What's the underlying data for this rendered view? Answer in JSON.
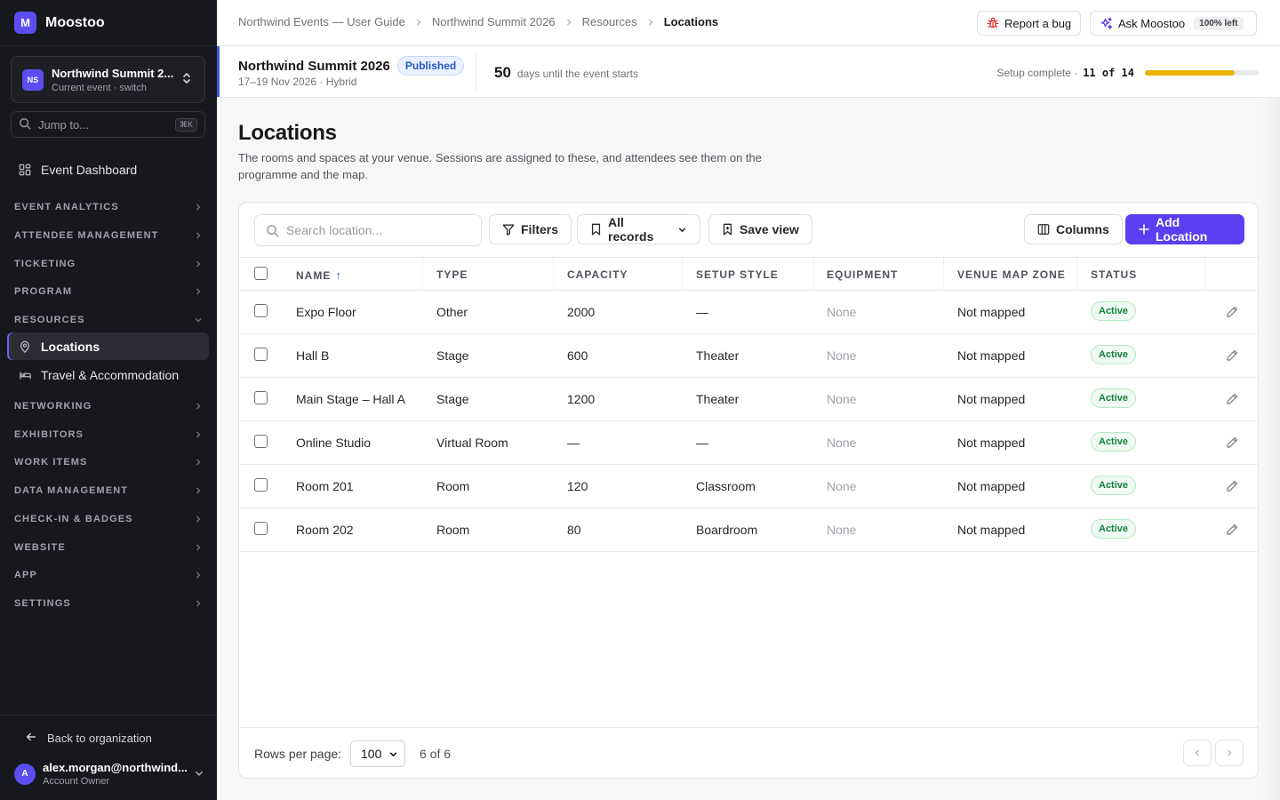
{
  "app": {
    "logo_letter": "M",
    "name": "Moostoo",
    "accent": "#5b3ff0"
  },
  "sidebar": {
    "event": {
      "initials": "NS",
      "name": "Northwind Summit 2...",
      "subtitle": "Current event · switch"
    },
    "jump": {
      "placeholder": "Jump to...",
      "shortcut": "⌘K"
    },
    "dashboard_label": "Event Dashboard",
    "sections": [
      {
        "label": "EVENT ANALYTICS",
        "expanded": false
      },
      {
        "label": "ATTENDEE MANAGEMENT",
        "expanded": false
      },
      {
        "label": "TICKETING",
        "expanded": false
      },
      {
        "label": "PROGRAM",
        "expanded": false
      },
      {
        "label": "RESOURCES",
        "expanded": true
      },
      {
        "label": "NETWORKING",
        "expanded": false
      },
      {
        "label": "EXHIBITORS",
        "expanded": false
      },
      {
        "label": "WORK ITEMS",
        "expanded": false
      },
      {
        "label": "DATA MANAGEMENT",
        "expanded": false
      },
      {
        "label": "CHECK-IN & BADGES",
        "expanded": false
      },
      {
        "label": "WEBSITE",
        "expanded": false
      },
      {
        "label": "APP",
        "expanded": false
      },
      {
        "label": "SETTINGS",
        "expanded": false
      }
    ],
    "resources_items": [
      {
        "label": "Locations",
        "icon": "map-pin-icon",
        "active": true
      },
      {
        "label": "Travel & Accommodation",
        "icon": "bed-icon",
        "active": false
      }
    ],
    "back_label": "Back to organization",
    "user": {
      "initial": "A",
      "email": "alex.morgan@northwind...",
      "role": "Account Owner"
    }
  },
  "topbar": {
    "breadcrumbs": [
      "Northwind Events — User Guide",
      "Northwind Summit 2026",
      "Resources"
    ],
    "current": "Locations",
    "report_label": "Report a bug",
    "ask_label": "Ask Moostoo",
    "ask_quota": "100% left"
  },
  "eventbar": {
    "name": "Northwind Summit 2026",
    "status": "Published",
    "dates": "17–19 Nov 2026 · Hybrid",
    "days": "50",
    "days_label": "days until the event starts",
    "setup_label": "Setup complete ·",
    "setup_count": "11 of 14",
    "setup_progress": 0.786
  },
  "page": {
    "title": "Locations",
    "description": "The rooms and spaces at your venue. Sessions are assigned to these, and attendees see them on the programme and the map."
  },
  "toolbar": {
    "search_placeholder": "Search location...",
    "filters": "Filters",
    "view": "All records",
    "save_view": "Save view",
    "columns": "Columns",
    "add": "Add Location"
  },
  "table": {
    "columns": [
      "NAME",
      "TYPE",
      "CAPACITY",
      "SETUP STYLE",
      "EQUIPMENT",
      "VENUE MAP ZONE",
      "STATUS"
    ],
    "sort_indicator": "↑",
    "rows": [
      {
        "name": "Expo Floor",
        "type": "Other",
        "capacity": "2000",
        "setup": "—",
        "equipment": "None",
        "zone": "Not mapped",
        "status": "Active"
      },
      {
        "name": "Hall B",
        "type": "Stage",
        "capacity": "600",
        "setup": "Theater",
        "equipment": "None",
        "zone": "Not mapped",
        "status": "Active"
      },
      {
        "name": "Main Stage – Hall A",
        "type": "Stage",
        "capacity": "1200",
        "setup": "Theater",
        "equipment": "None",
        "zone": "Not mapped",
        "status": "Active"
      },
      {
        "name": "Online Studio",
        "type": "Virtual Room",
        "capacity": "—",
        "setup": "—",
        "equipment": "None",
        "zone": "Not mapped",
        "status": "Active"
      },
      {
        "name": "Room 201",
        "type": "Room",
        "capacity": "120",
        "setup": "Classroom",
        "equipment": "None",
        "zone": "Not mapped",
        "status": "Active"
      },
      {
        "name": "Room 202",
        "type": "Room",
        "capacity": "80",
        "setup": "Boardroom",
        "equipment": "None",
        "zone": "Not mapped",
        "status": "Active"
      }
    ]
  },
  "pagination": {
    "rows_per_page_label": "Rows per page:",
    "rows_per_page": "100",
    "count": "6 of 6"
  }
}
